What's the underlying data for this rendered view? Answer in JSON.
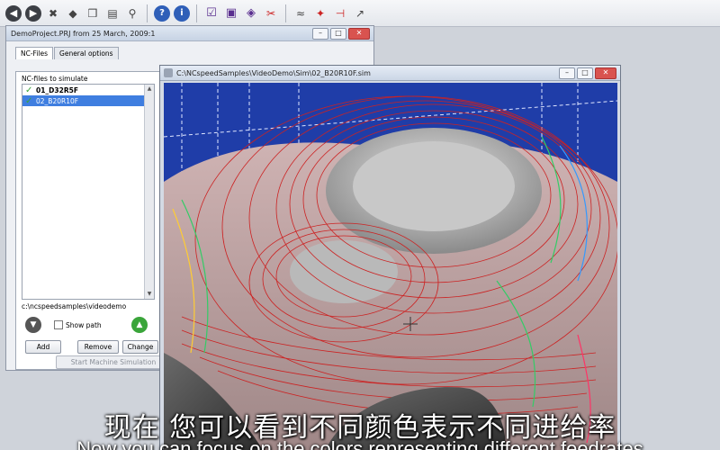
{
  "toolbar": {
    "icons": [
      "back-icon",
      "forward-icon",
      "wrench-icon",
      "cube-icon",
      "box-icon",
      "print-icon",
      "tool-icon",
      "help-icon",
      "info-icon",
      "checklist-icon",
      "image-icon",
      "color-icon",
      "cut-icon",
      "feed-icon",
      "collision-icon",
      "axis-icon",
      "dimension-icon"
    ]
  },
  "project_window": {
    "title": "DemoProject.PRJ from 25 March, 2009:1",
    "tabs": [
      "NC-Files",
      "General options"
    ],
    "group_label": "NC-files to simulate",
    "files": [
      {
        "name": "01_D32R5F",
        "checked": true,
        "selected": false
      },
      {
        "name": "02_B20R10F",
        "checked": true,
        "selected": true
      }
    ],
    "path": "c:\\ncspeedsamples\\videodemo",
    "show_path_label": "Show path",
    "show_path_checked": false,
    "add_label": "Add",
    "remove_label": "Remove",
    "change_label": "Change",
    "start_label": "Start Machine Simulation",
    "obscured_label": "Ma"
  },
  "sim_window": {
    "title": "C:\\NCspeedSamples\\VideoDemo\\Sim\\02_B20R10F.sim"
  },
  "subtitles": {
    "chinese": "现在  您可以看到不同颜色表示不同进给率",
    "english": "Now you can focus on the colors representing different feedrates"
  },
  "colors": {
    "viewport_bg": "#1f3da8",
    "part_surface": "#c9a8a8",
    "toolpath": "#cc2222",
    "accent_selection": "#3f7ee0"
  }
}
